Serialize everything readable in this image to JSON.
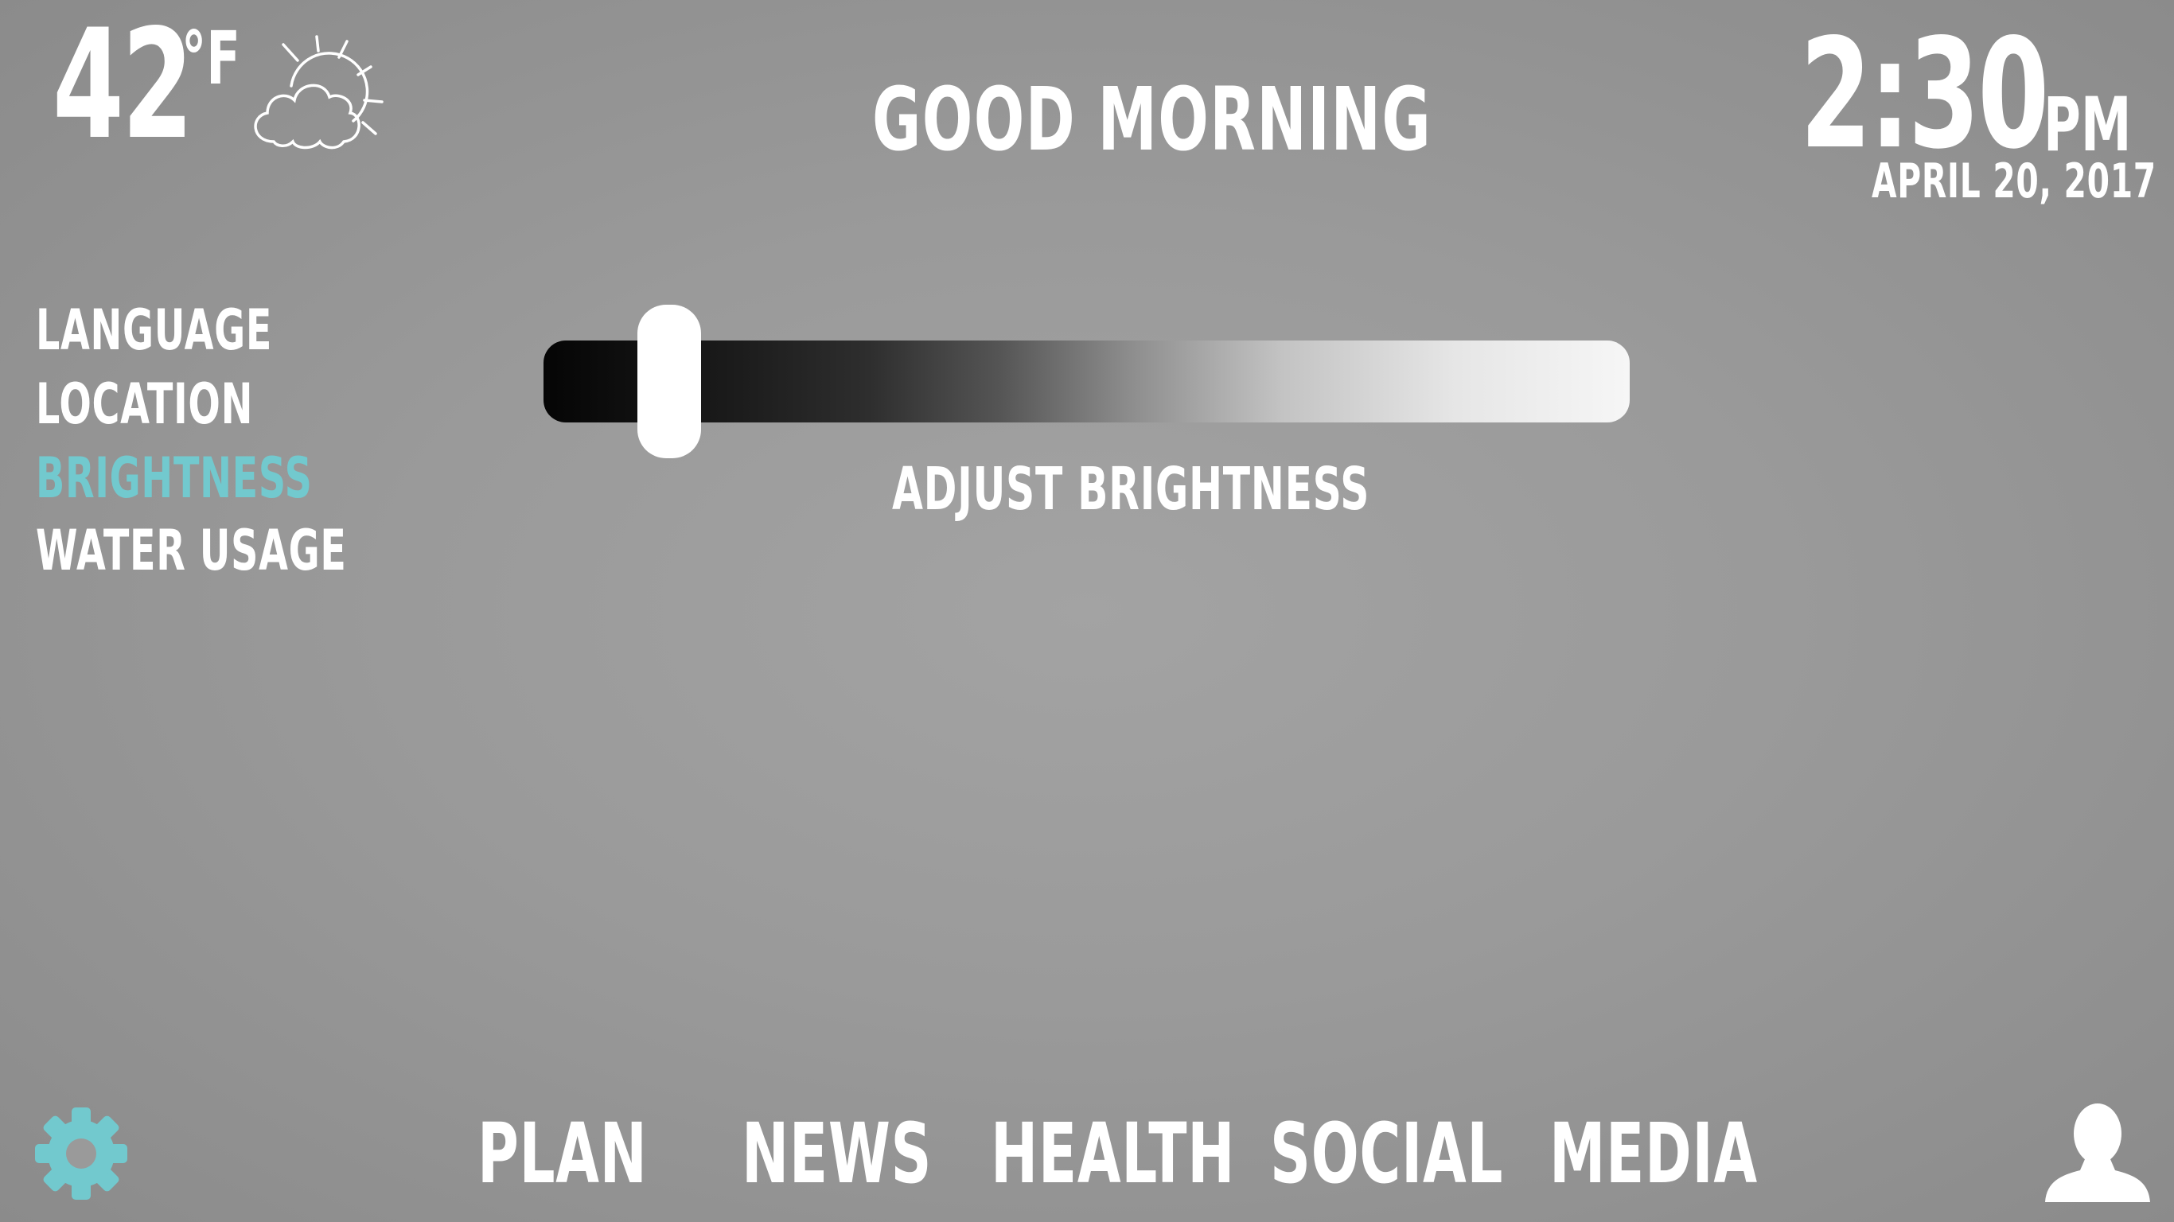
{
  "weather": {
    "temperature": "42",
    "unit": "°F",
    "icon": "partly-cloudy-icon"
  },
  "header": {
    "greeting": "GOOD MORNING"
  },
  "clock": {
    "time": "2:30",
    "ampm": "PM",
    "date": "APRIL 20, 2017"
  },
  "settings_menu": {
    "items": [
      {
        "label": "LANGUAGE"
      },
      {
        "label": "LOCATION"
      },
      {
        "label": "BRIGHTNESS",
        "active": true
      },
      {
        "label": "WATER USAGE"
      }
    ]
  },
  "brightness": {
    "label": "ADJUST BRIGHTNESS",
    "level_fraction": 0.11
  },
  "nav": {
    "items": [
      {
        "label": "PLAN"
      },
      {
        "label": "NEWS"
      },
      {
        "label": "HEALTH"
      },
      {
        "label": "SOCIAL"
      },
      {
        "label": "MEDIA"
      }
    ],
    "settings_icon": "gear-icon",
    "profile_icon": "user-icon"
  },
  "colors": {
    "accent": "#72c9ce",
    "text": "#ffffff",
    "background": "#9a9a9a"
  }
}
